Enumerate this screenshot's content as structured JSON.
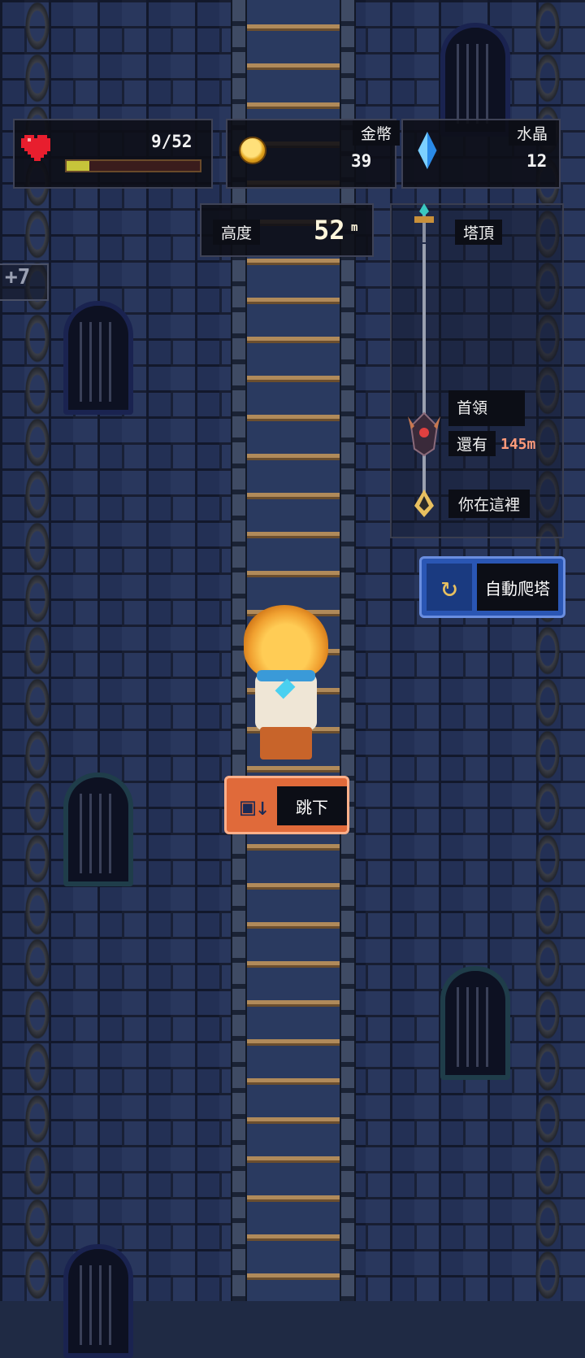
{
  "hud": {
    "hp": {
      "current": 9,
      "max": 52,
      "text": "9/52",
      "fill_fraction": 0.17
    },
    "gold": {
      "label": "金幣",
      "value": "39"
    },
    "crystal": {
      "label": "水晶",
      "value": "12"
    },
    "height": {
      "label": "高度",
      "value": "52",
      "unit": "m"
    }
  },
  "progress": {
    "top_label": "塔頂",
    "boss_label": "首領",
    "remaining_prefix": "還有",
    "remaining_value": "145m",
    "you_label": "你在這裡"
  },
  "buttons": {
    "auto_climb": "自動爬塔",
    "jump_down": "跳下"
  },
  "floating": {
    "gain_text": "+7"
  },
  "colors": {
    "wall": "#25335a",
    "auto_button": "#2a56b4",
    "jump_button": "#e06a3a",
    "hp_fill": "#c7c43a",
    "remaining_value": "#ff9a7a"
  }
}
